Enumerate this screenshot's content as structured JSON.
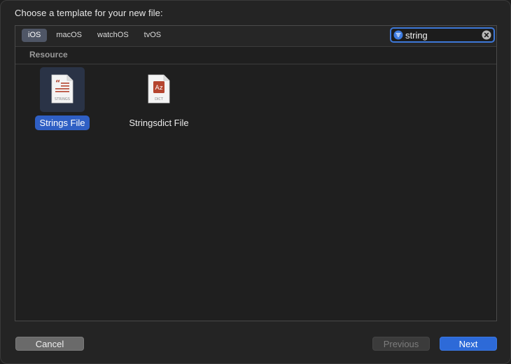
{
  "dialog": {
    "title": "Choose a template for your new file:"
  },
  "platform_tabs": [
    {
      "label": "iOS",
      "active": true
    },
    {
      "label": "macOS",
      "active": false
    },
    {
      "label": "watchOS",
      "active": false
    },
    {
      "label": "tvOS",
      "active": false
    }
  ],
  "search": {
    "value": "string",
    "filter_icon": "filter-icon",
    "clear_icon": "clear-icon"
  },
  "section": {
    "title": "Resource"
  },
  "templates": [
    {
      "label": "Strings File",
      "icon_text": "STRINGS",
      "icon": "strings-file-icon",
      "selected": true
    },
    {
      "label": "Stringsdict File",
      "icon_text": "DICT",
      "icon_glyph": "Az",
      "icon": "stringsdict-file-icon",
      "selected": false
    }
  ],
  "buttons": {
    "cancel": "Cancel",
    "previous": "Previous",
    "next": "Next"
  },
  "colors": {
    "accent": "#2d6ad8",
    "selection": "#2f5fc4",
    "icon_red": "#b5452f"
  }
}
